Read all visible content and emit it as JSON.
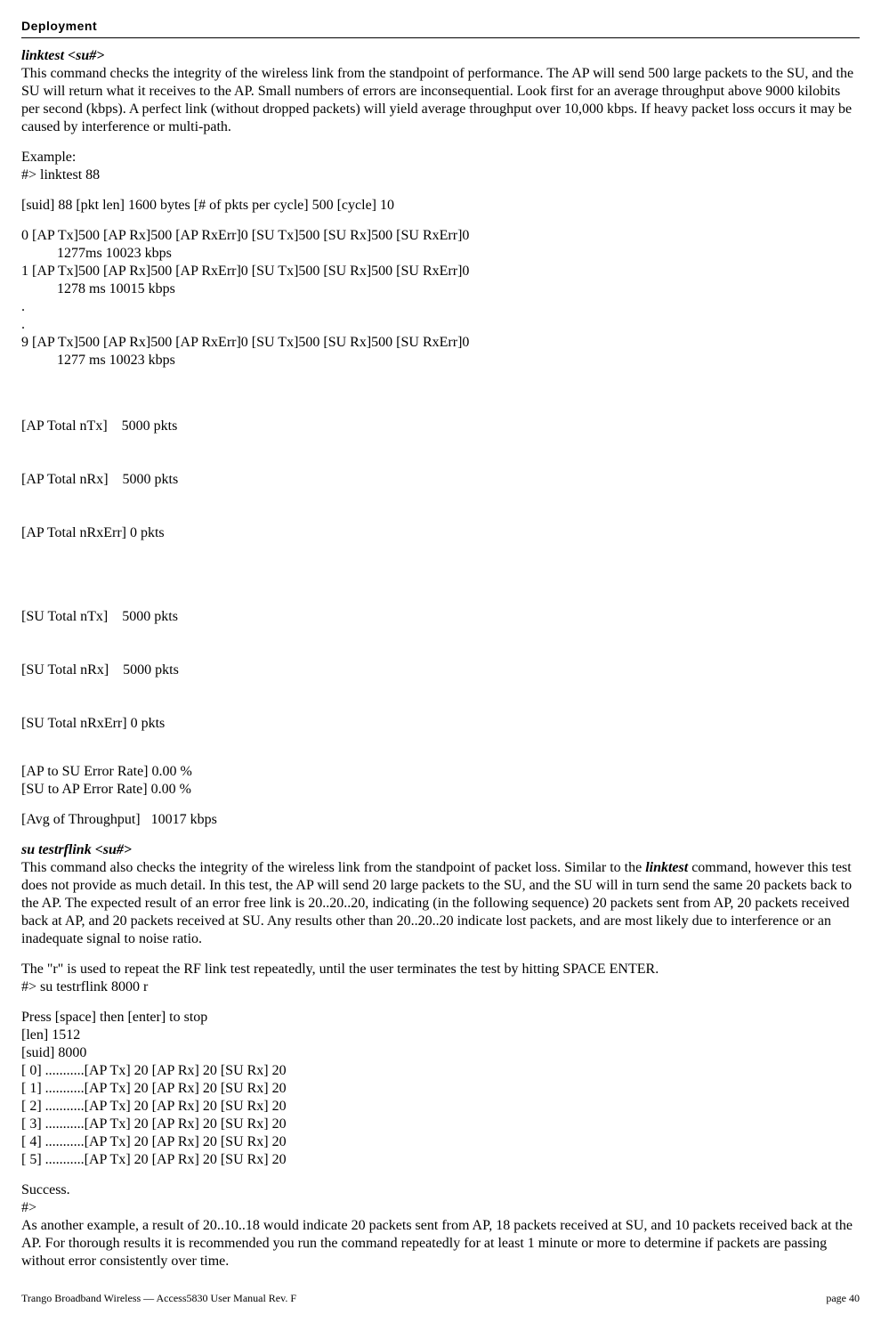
{
  "header": {
    "section_title": "Deployment"
  },
  "linktest": {
    "heading": "linktest  <su#>",
    "desc": "This command checks the integrity of the wireless link from the standpoint of performance.  The AP will send 500 large packets to the SU, and the SU will return what it receives to the AP.  Small numbers of errors are inconsequential.  Look first for an average throughput above 9000 kilobits per second (kbps).  A perfect link (without dropped packets) will yield average throughput over 10,000 kbps.  If heavy packet loss occurs it may be caused by interference or multi-path.",
    "example_label": "Example:",
    "example_cmd": "#> linktest 88",
    "suid_line": "[suid] 88 [pkt len] 1600 bytes [# of pkts per cycle] 500 [cycle] 10",
    "cycles": [
      {
        "line": "0  [AP Tx]500 [AP Rx]500 [AP RxErr]0  [SU Tx]500 [SU Rx]500 [SU RxErr]0",
        "rate": "1277ms  10023 kbps"
      },
      {
        "line": "1  [AP Tx]500 [AP Rx]500 [AP RxErr]0  [SU Tx]500 [SU Rx]500 [SU RxErr]0",
        "rate": "1278 ms  10015 kbps"
      }
    ],
    "dots": [
      ".",
      "."
    ],
    "last_cycle": {
      "line": "9  [AP Tx]500 [AP Rx]500 [AP RxErr]0  [SU Tx]500 [SU Rx]500 [SU RxErr]0",
      "rate": "1277 ms  10023 kbps"
    },
    "ap_totals": [
      "[AP Total nTx]    5000 pkts",
      "[AP Total nRx]    5000 pkts",
      "[AP Total nRxErr] 0 pkts"
    ],
    "su_totals": [
      "[SU Total nTx]    5000 pkts",
      "[SU Total nRx]    5000 pkts",
      "[SU Total nRxErr] 0 pkts"
    ],
    "error_rates": [
      "[AP to SU Error Rate] 0.00 %",
      "[SU to AP Error Rate] 0.00 %"
    ],
    "avg_throughput": "[Avg of Throughput]   10017 kbps"
  },
  "testrflink": {
    "heading": "su testrflink <su#>",
    "desc_pre": "This command also checks the integrity of the wireless link from the standpoint of packet loss.  Similar to the ",
    "desc_bold": "linktest",
    "desc_post": " command, however this test does not provide as much detail.  In this test, the AP will send 20 large packets to the SU, and the SU will in turn send the same 20 packets back to the AP.  The expected result of an error free link is 20..20..20, indicating (in the following sequence) 20 packets sent from AP, 20 packets received back at AP, and 20 packets received at SU.  Any results other than 20..20..20 indicate lost packets, and are most likely due to interference or an inadequate signal to noise ratio.",
    "r_note": "The \"r\" is used to repeat the RF link test repeatedly, until the user terminates the test by hitting SPACE ENTER.",
    "cmd": "#> su testrflink 8000 r",
    "press_line": "Press [space] then [enter] to stop",
    "len_line": "[len] 1512",
    "suid_line": "[suid] 8000",
    "rows": [
      "[   0] ...........[AP Tx] 20 [AP Rx] 20 [SU Rx] 20",
      "[   1] ...........[AP Tx] 20 [AP Rx] 20 [SU Rx] 20",
      "[   2] ...........[AP Tx] 20 [AP Rx] 20 [SU Rx] 20",
      "[   3] ...........[AP Tx] 20 [AP Rx] 20 [SU Rx] 20",
      "[   4] ...........[AP Tx] 20 [AP Rx] 20 [SU Rx] 20",
      "[   5] ...........[AP Tx] 20 [AP Rx] 20 [SU Rx] 20"
    ],
    "success": "Success.",
    "prompt": "#>",
    "tail": "As another example, a result of 20..10..18 would indicate 20 packets sent from AP, 18 packets received at SU, and 10 packets received back at the AP.  For thorough results it is recommended you run the command repeatedly for at least 1 minute or more to determine if packets are passing without error consistently over time."
  },
  "footer": {
    "left": "Trango Broadband Wireless — Access5830 User Manual  Rev. F",
    "right": "page 40"
  }
}
